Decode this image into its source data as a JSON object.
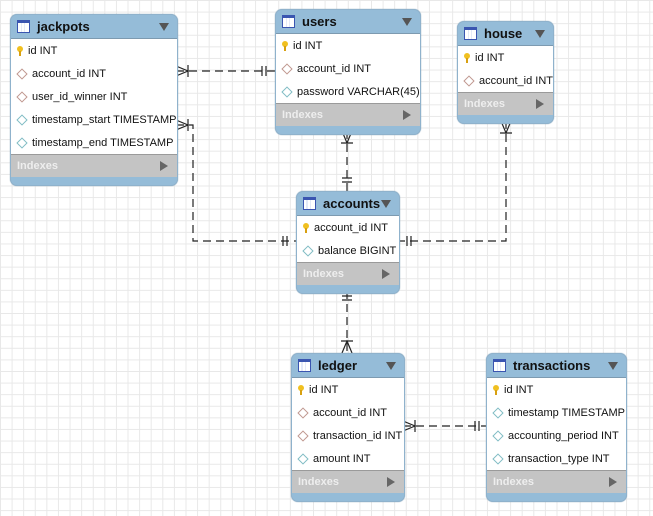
{
  "indexes_label": "Indexes",
  "tables": [
    {
      "name": "jackpots",
      "columns": [
        {
          "label": "id INT",
          "kind": "pk"
        },
        {
          "label": "account_id INT",
          "kind": "fk"
        },
        {
          "label": "user_id_winner INT",
          "kind": "fk"
        },
        {
          "label": "timestamp_start TIMESTAMP",
          "kind": "col"
        },
        {
          "label": "timestamp_end TIMESTAMP",
          "kind": "col"
        }
      ]
    },
    {
      "name": "users",
      "columns": [
        {
          "label": "id INT",
          "kind": "pk"
        },
        {
          "label": "account_id INT",
          "kind": "fk"
        },
        {
          "label": "password VARCHAR(45)",
          "kind": "col"
        }
      ]
    },
    {
      "name": "house",
      "columns": [
        {
          "label": "id INT",
          "kind": "pk"
        },
        {
          "label": "account_id INT",
          "kind": "fk"
        }
      ]
    },
    {
      "name": "accounts",
      "columns": [
        {
          "label": "account_id INT",
          "kind": "pk"
        },
        {
          "label": "balance BIGINT",
          "kind": "col"
        }
      ]
    },
    {
      "name": "ledger",
      "columns": [
        {
          "label": "id INT",
          "kind": "pk"
        },
        {
          "label": "account_id INT",
          "kind": "fk"
        },
        {
          "label": "transaction_id INT",
          "kind": "fk"
        },
        {
          "label": "amount INT",
          "kind": "col"
        }
      ]
    },
    {
      "name": "transactions",
      "columns": [
        {
          "label": "id INT",
          "kind": "pk"
        },
        {
          "label": "timestamp TIMESTAMP",
          "kind": "col"
        },
        {
          "label": "accounting_period INT",
          "kind": "col"
        },
        {
          "label": "transaction_type INT",
          "kind": "col"
        }
      ]
    }
  ],
  "relationships": [
    {
      "from": "jackpots",
      "to": "users",
      "from_cardinality": "many",
      "to_cardinality": "one"
    },
    {
      "from": "jackpots",
      "to": "accounts",
      "from_cardinality": "many",
      "to_cardinality": "one"
    },
    {
      "from": "users",
      "to": "accounts",
      "from_cardinality": "many",
      "to_cardinality": "one"
    },
    {
      "from": "house",
      "to": "accounts",
      "from_cardinality": "many",
      "to_cardinality": "one"
    },
    {
      "from": "ledger",
      "to": "accounts",
      "from_cardinality": "many",
      "to_cardinality": "one"
    },
    {
      "from": "ledger",
      "to": "transactions",
      "from_cardinality": "many",
      "to_cardinality": "one"
    }
  ],
  "colors": {
    "header": "#95bcd8",
    "indexes": "#c4c4c4",
    "line": "#222222"
  }
}
